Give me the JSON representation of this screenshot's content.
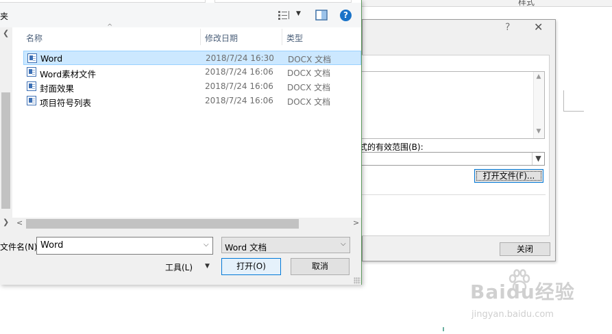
{
  "background_window": {
    "ribbon_label": "样式"
  },
  "style_dialog": {
    "help_glyph": "?",
    "close_glyph": "✕",
    "scope_label": "样式的有效范围(B):",
    "open_file_button": "打开文件(F)...",
    "close_button": "关闭"
  },
  "open_dialog": {
    "org_label": "夹",
    "help_glyph": "?",
    "columns": {
      "name": "名称",
      "date": "修改日期",
      "type": "类型"
    },
    "files": [
      {
        "name": "Word",
        "date": "2018/7/24 16:30",
        "type": "DOCX 文档",
        "selected": true
      },
      {
        "name": "Word素材文件",
        "date": "2018/7/24 16:06",
        "type": "DOCX 文档",
        "selected": false
      },
      {
        "name": "封面效果",
        "date": "2018/7/24 16:06",
        "type": "DOCX 文档",
        "selected": false
      },
      {
        "name": "项目符号列表",
        "date": "2018/7/24 16:06",
        "type": "DOCX 文档",
        "selected": false
      }
    ],
    "filename_label": "文件名(N):",
    "filename_value": "Word",
    "filetype_value": "Word 文档",
    "tools_label": "工具(L)",
    "open_button": "打开(O)",
    "cancel_button": "取消"
  },
  "watermark": {
    "logo": "Baidu经验",
    "url": "jingyan.baidu.com"
  },
  "colors": {
    "selection": "#cce8ff",
    "accent": "#0078d7",
    "dialog_border": "#5d9a5d"
  }
}
